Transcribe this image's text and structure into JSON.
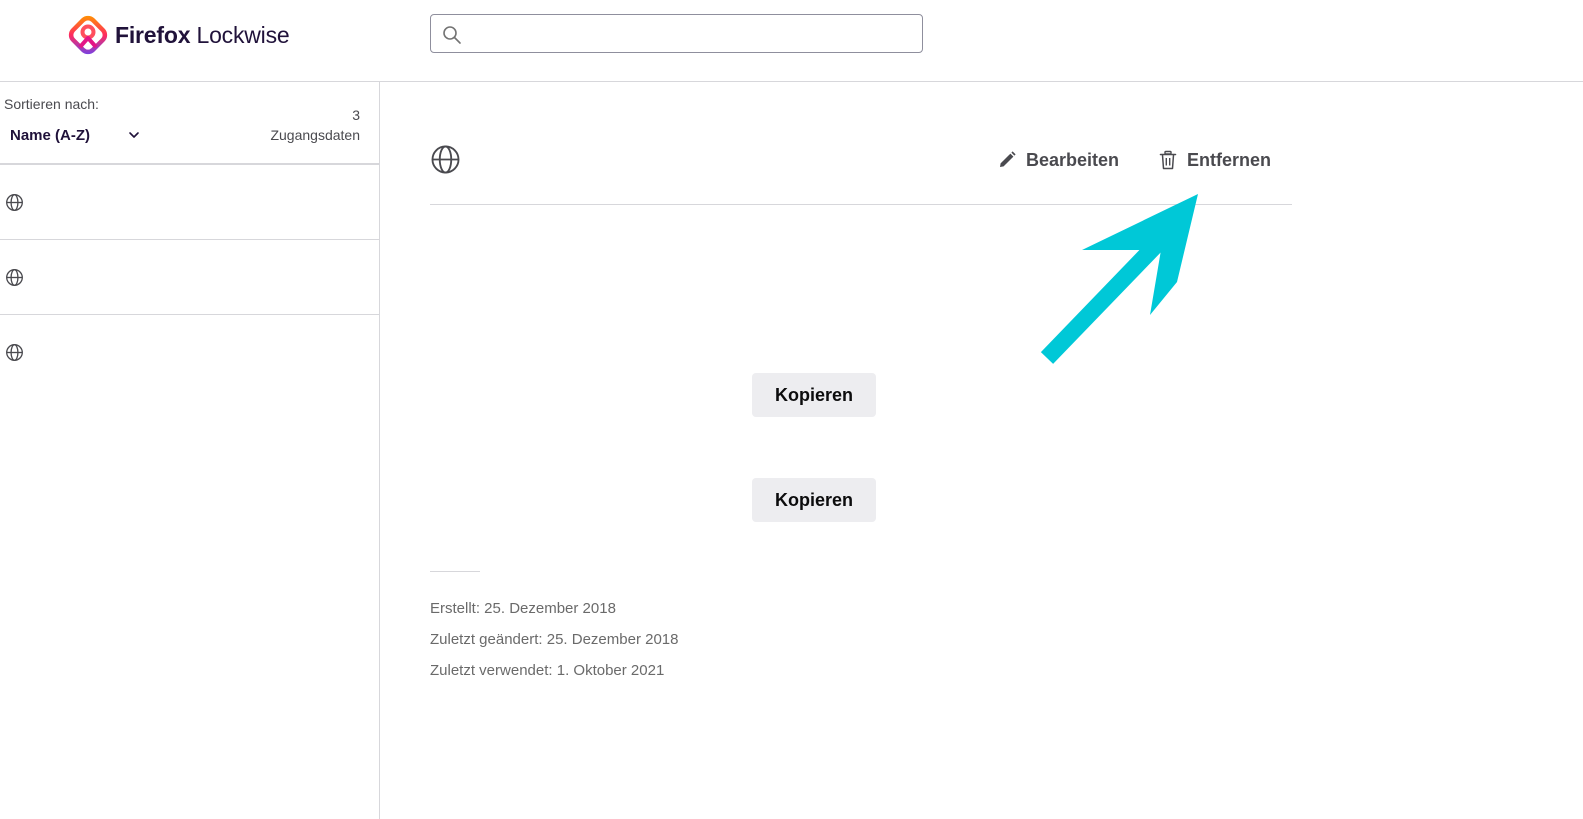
{
  "app": {
    "brand_bold": "Firefox",
    "brand_light": " Lockwise"
  },
  "search": {
    "placeholder": "",
    "value": ""
  },
  "sidebar": {
    "sort_label": "Sortieren nach:",
    "sort_value": "Name (A-Z)",
    "count_number": "3",
    "count_label": "Zugangsdaten",
    "items": [
      {
        "icon": "globe-icon",
        "title": "",
        "subtitle": ""
      },
      {
        "icon": "globe-icon",
        "title": "",
        "subtitle": ""
      },
      {
        "icon": "globe-icon",
        "title": "",
        "subtitle": ""
      }
    ]
  },
  "detail": {
    "icon": "globe-icon",
    "edit_label": "Bearbeiten",
    "delete_label": "Entfernen",
    "copy_username_label": "Kopieren",
    "copy_password_label": "Kopieren",
    "created": "Erstellt: 25. Dezember 2018",
    "modified": "Zuletzt geändert: 25. Dezember 2018",
    "last_used": "Zuletzt verwendet: 1. Oktober 2021"
  },
  "colors": {
    "annotation_arrow": "#00c8d7",
    "text_primary": "#20123a",
    "button_bg": "#ededf0"
  }
}
